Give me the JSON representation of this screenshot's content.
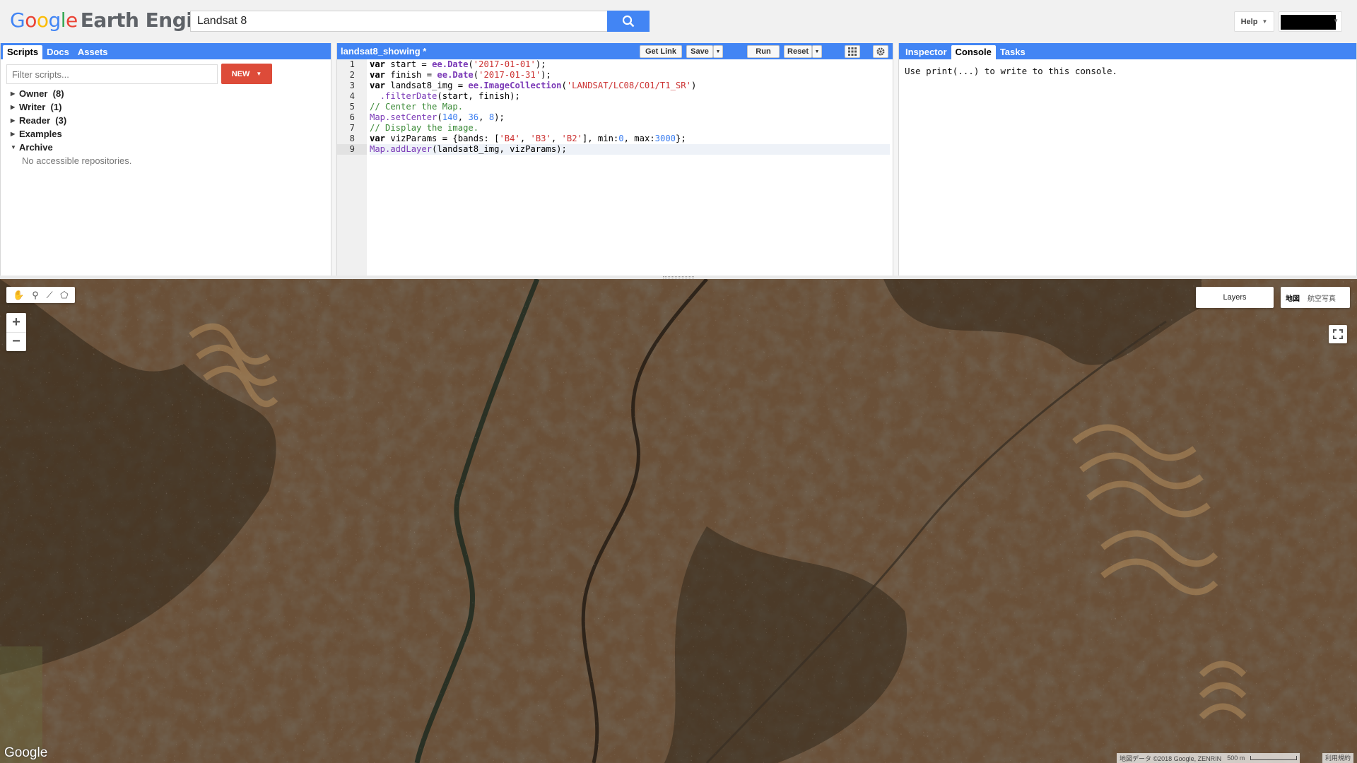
{
  "logo": {
    "google": [
      "G",
      "o",
      "o",
      "g",
      "l",
      "e"
    ],
    "product": "Earth Engine"
  },
  "search": {
    "value": "Landsat 8",
    "icon": "search-icon"
  },
  "header": {
    "help_label": "Help"
  },
  "left_panel": {
    "tabs": [
      "Scripts",
      "Docs",
      "Assets"
    ],
    "filter_placeholder": "Filter scripts...",
    "new_label": "NEW",
    "tree": [
      {
        "label": "Owner  (8)",
        "expanded": false
      },
      {
        "label": "Writer  (1)",
        "expanded": false
      },
      {
        "label": "Reader  (3)",
        "expanded": false
      },
      {
        "label": "Examples",
        "expanded": false
      },
      {
        "label": "Archive",
        "expanded": true
      }
    ],
    "archive_note": "No accessible repositories."
  },
  "code_panel": {
    "title": "landsat8_showing *",
    "buttons": {
      "get_link": "Get Link",
      "save": "Save",
      "run": "Run",
      "reset": "Reset"
    },
    "line_numbers": [
      "1",
      "2",
      "3",
      "4",
      "5",
      "6",
      "7",
      "8",
      "9"
    ],
    "code_lines": [
      "var start = ee.Date('2017-01-01');",
      "var finish = ee.Date('2017-01-31');",
      "var landsat8_img = ee.ImageCollection('LANDSAT/LC08/C01/T1_SR')",
      "  .filterDate(start, finish);",
      "// Center the Map.",
      "Map.setCenter(140, 36, 8);",
      "// Display the image.",
      "var vizParams = {bands: ['B4', 'B3', 'B2'], min:0, max:3000};",
      "Map.addLayer(landsat8_img, vizParams);"
    ]
  },
  "right_panel": {
    "tabs": [
      "Inspector",
      "Console",
      "Tasks"
    ],
    "active_tab": "Console",
    "console_message": "Use print(...) to write to this console."
  },
  "map": {
    "layers_label": "Layers",
    "map_types": [
      "地図",
      "航空写真"
    ],
    "zoom_in": "+",
    "zoom_out": "−",
    "google_mark": "Google",
    "attribution": "地図データ ©2018 Google, ZENRIN",
    "scale_label": "500 m",
    "terms": "利用規約"
  },
  "colors": {
    "accent": "#4285f4",
    "new_button": "#dd4b39",
    "map_base": "#5a4532"
  }
}
